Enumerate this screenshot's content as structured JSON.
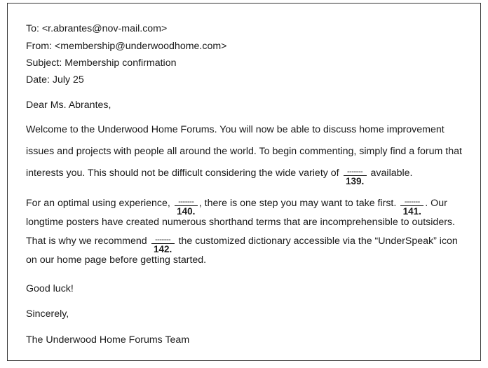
{
  "email": {
    "to": "To: <r.abrantes@nov-mail.com>",
    "from": "From: <membership@underwoodhome.com>",
    "subject": "Subject: Membership confirmation",
    "date": "Date: July 25",
    "greeting": "Dear Ms. Abrantes,",
    "p1": {
      "line1": "Welcome to the Underwood Home Forums. You will now be able to discuss home improvement",
      "line2": "issues and projects with people all around the world. To begin commenting, simply find a forum that",
      "line3_a": "interests you. This should not be difficult considering the wide variety of",
      "line3_b": "available."
    },
    "p2": {
      "line1_a": "For an optimal using experience,",
      "line1_b": ", there is one step you may want to take first.",
      "line1_c": ". Our",
      "line2": "longtime posters have created numerous shorthand terms that are incomprehensible to outsiders.",
      "line3_a": "That is why we recommend",
      "line3_b": "the customized dictionary accessible via the “UnderSpeak” icon",
      "line4": "on our home page before getting started."
    },
    "closing1": "Good luck!",
    "closing2": "Sincerely,",
    "signature": "The Underwood Home Forums Team"
  },
  "blanks": {
    "dash": "-------",
    "b139": "139.",
    "b140": "140.",
    "b141": "141.",
    "b142": "142."
  }
}
